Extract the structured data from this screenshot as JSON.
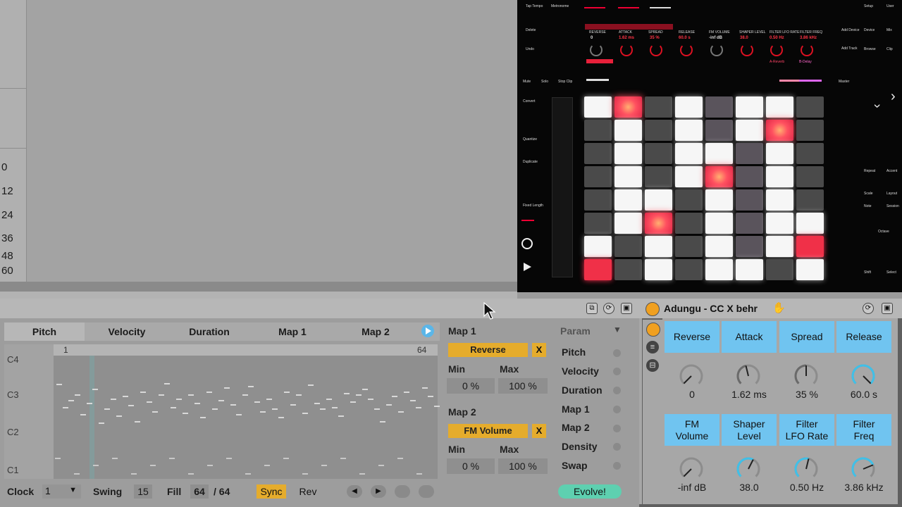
{
  "arrangement": {
    "octave_labels": [
      "0",
      "12",
      "24",
      "36",
      "48",
      "60"
    ]
  },
  "push": {
    "top_buttons": [
      "Tap Tempo",
      "Metronome",
      "Delete",
      "Undo",
      "Mute",
      "Solo",
      "Stop Clip",
      "Convert",
      "Quantize",
      "Duplicate",
      "Fixed Length"
    ],
    "right_buttons": [
      "Setup",
      "User",
      "Add Device",
      "Add Track",
      "Device",
      "Browse",
      "Mix",
      "Clip",
      "Master",
      "Repeat",
      "Accent",
      "Scale",
      "Layout",
      "Note",
      "Session",
      "Octave",
      "Shift",
      "Select"
    ],
    "param_labels": [
      "REVERSE",
      "ATTACK",
      "SPREAD",
      "RELEASE",
      "FM VOLUME",
      "SHAPER LEVEL",
      "FILTER LFO RATE",
      "FILTER FREQ"
    ],
    "param_values": [
      "0",
      "1.62 ms",
      "35 %",
      "60.0 s",
      "-inf dB",
      "38.0",
      "0.50 Hz",
      "3.86 kHz"
    ],
    "bank_labels": [
      "A-Reverb",
      "B-Delay"
    ]
  },
  "seq": {
    "tabs": [
      "Pitch",
      "Velocity",
      "Duration",
      "Map 1",
      "Map 2"
    ],
    "ruler_start": "1",
    "ruler_end": "64",
    "key_labels": [
      "C4",
      "C3",
      "C2",
      "C1"
    ],
    "map1": {
      "title": "Map 1",
      "target": "Reverse",
      "x": "X",
      "min_label": "Min",
      "max_label": "Max",
      "min": "0 %",
      "max": "100 %"
    },
    "map2": {
      "title": "Map 2",
      "target": "FM Volume",
      "x": "X",
      "min_label": "Min",
      "max_label": "Max",
      "min": "0 %",
      "max": "100 %"
    },
    "param_header": "Param",
    "params": [
      "Pitch",
      "Velocity",
      "Duration",
      "Map 1",
      "Map 2",
      "Density",
      "Swap"
    ],
    "bottom": {
      "clock_label": "Clock",
      "clock_value": "1",
      "swing_label": "Swing",
      "swing_value": "15",
      "fill_label": "Fill",
      "fill_value": "64",
      "fill_total": "/ 64",
      "sync": "Sync",
      "rev": "Rev",
      "evolve": "Evolve!"
    }
  },
  "rack": {
    "title": "Adungu - CC X behr",
    "macros": [
      {
        "name": "Reverse",
        "value": "0"
      },
      {
        "name": "Attack",
        "value": "1.62 ms"
      },
      {
        "name": "Spread",
        "value": "35 %"
      },
      {
        "name": "Release",
        "value": "60.0 s"
      },
      {
        "name": "FM\nVolume",
        "value": "-inf dB"
      },
      {
        "name": "Shaper\nLevel",
        "value": "38.0"
      },
      {
        "name": "Filter\nLFO Rate",
        "value": "0.50 Hz"
      },
      {
        "name": "Filter\nFreq",
        "value": "3.86 kHz"
      }
    ]
  },
  "colors": {
    "accent_orange": "#e5ac2c",
    "macro_blue": "#70c4f0",
    "evolve_green": "#5ed0b0",
    "pad_red": "#f03048"
  }
}
